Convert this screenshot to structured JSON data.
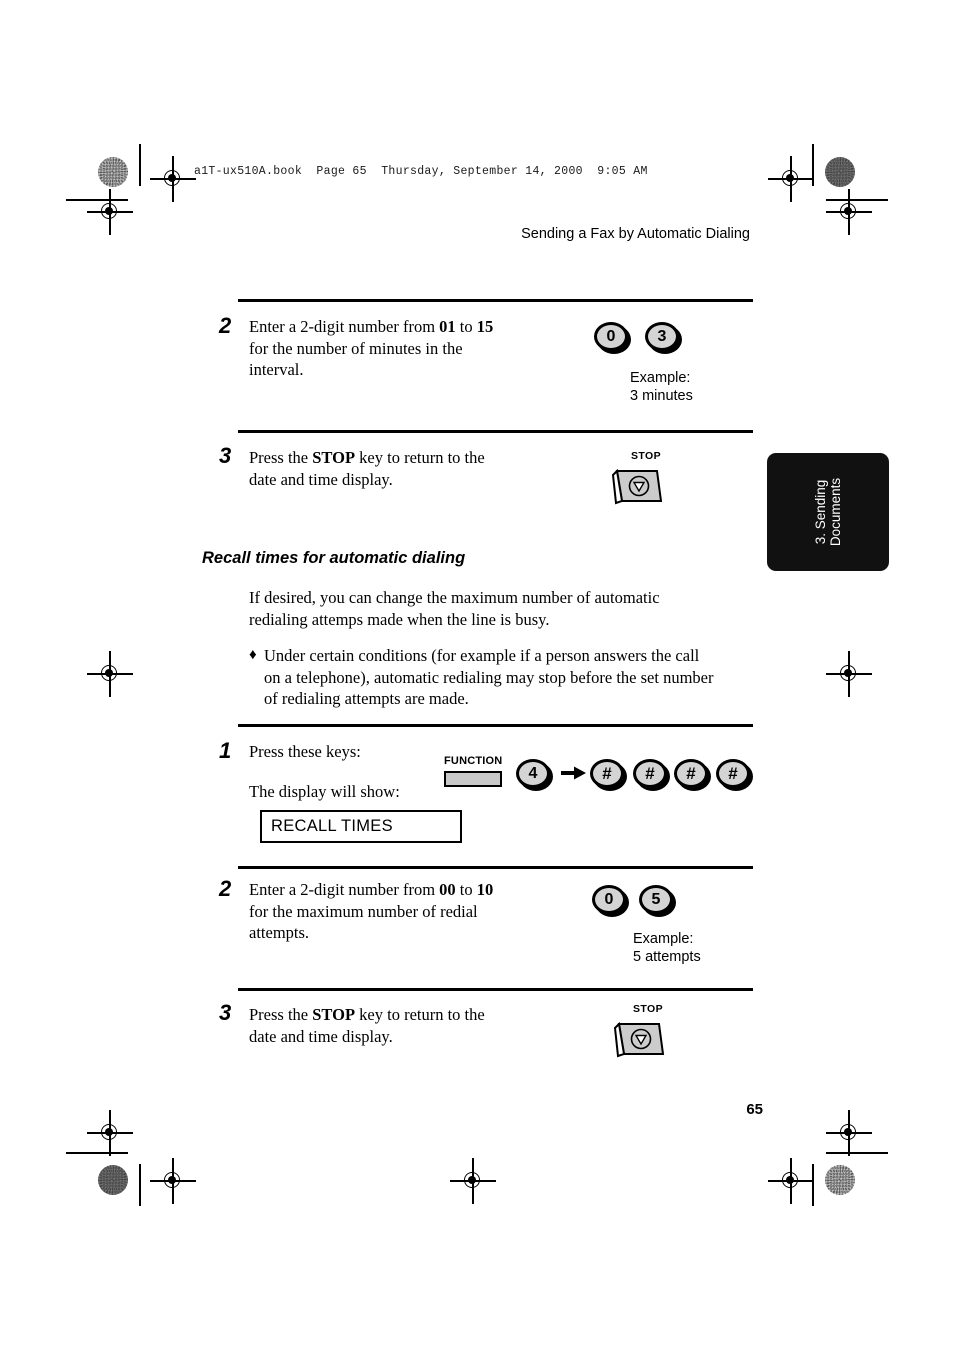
{
  "page": {
    "book_header": "a1T-ux510A.book  Page 65  Thursday, September 14, 2000  9:05 AM",
    "running_head": "Sending a Fax by Automatic Dialing",
    "folio": "65",
    "side_tab": "3. Sending\nDocuments"
  },
  "steps": [
    {
      "number": "2",
      "line1_pre": "Enter a 2-digit number from ",
      "line1_b1": "01",
      "line1_mid": " to ",
      "line1_b2": "15",
      "line2": "for the number of minutes in the",
      "line3": "interval.",
      "keys": [
        "0",
        "3"
      ],
      "example": "Example:\n3 minutes"
    },
    {
      "number": "3",
      "text_pre": "Press the ",
      "text_bold": "STOP",
      "text_post": " key to return to the",
      "text_line2": "date and time display.",
      "key_label": "STOP"
    },
    {
      "number": "1",
      "prompt": "Press these keys:",
      "display_prompt": "The display will show:",
      "function_label": "FUNCTION",
      "key_4": "4",
      "hash_keys": [
        "#",
        "#",
        "#",
        "#"
      ],
      "lcd_text": "RECALL TIMES"
    },
    {
      "number": "2",
      "line1_pre": "Enter a 2-digit number from ",
      "line1_b1": "00",
      "line1_mid": " to ",
      "line1_b2": "10",
      "line2": "for the maximum number of redial",
      "line3": "attempts.",
      "keys": [
        "0",
        "5"
      ],
      "example": "Example:\n5 attempts"
    },
    {
      "number": "3",
      "text_pre": "Press the ",
      "text_bold": "STOP",
      "text_post": " key to return to the",
      "text_line2": "date and time display.",
      "key_label": "STOP"
    }
  ],
  "section": {
    "heading": "Recall times for automatic dialing",
    "para_line1": "If desired, you can change the maximum number of automatic",
    "para_line2": "redialing attemps made when the line is busy.",
    "bullet_mark": "♦",
    "bullet_line1": "Under certain conditions (for example if a person answers the call",
    "bullet_line2": "on a telephone), automatic redialing may stop before the set number",
    "bullet_line3": "of redialing attempts are made."
  },
  "colors": {
    "key_face": "#d4d4d4",
    "tab_bg": "#111111",
    "rule": "#000000"
  }
}
